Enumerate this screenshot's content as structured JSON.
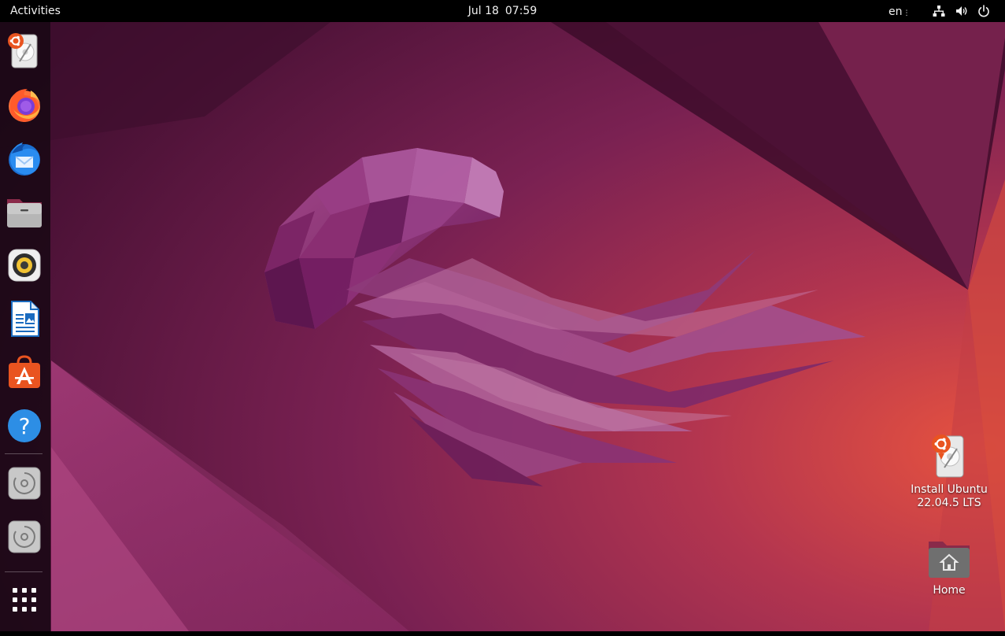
{
  "topbar": {
    "activities_label": "Activities",
    "date": "Jul 18",
    "time": "07:59",
    "input_source": "en",
    "status_icons": [
      "network-wired-icon",
      "volume-icon",
      "power-icon"
    ]
  },
  "dock": {
    "items": [
      {
        "name": "install-ubuntu",
        "icon": "installer-icon"
      },
      {
        "name": "firefox",
        "icon": "firefox-icon"
      },
      {
        "name": "thunderbird",
        "icon": "thunderbird-icon"
      },
      {
        "name": "files",
        "icon": "files-icon"
      },
      {
        "name": "rhythmbox",
        "icon": "rhythmbox-icon"
      },
      {
        "name": "libreoffice-writer",
        "icon": "writer-icon"
      },
      {
        "name": "ubuntu-software",
        "icon": "software-icon"
      },
      {
        "name": "help",
        "icon": "help-icon"
      },
      {
        "name": "disc-1",
        "icon": "optical-disc-icon"
      },
      {
        "name": "disc-2",
        "icon": "optical-disc-icon"
      },
      {
        "name": "show-applications",
        "icon": "app-grid-icon"
      }
    ]
  },
  "desktop_icons": [
    {
      "name": "install-ubuntu",
      "label_line1": "Install Ubuntu",
      "label_line2": "22.04.5 LTS"
    },
    {
      "name": "home",
      "label_line1": "Home"
    }
  ],
  "colors": {
    "topbar": "#000000",
    "ubuntu_orange": "#e95420",
    "aubergine": "#5a1744",
    "jellyfish": "#8e2b72"
  }
}
